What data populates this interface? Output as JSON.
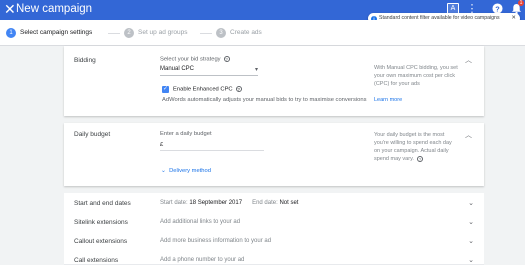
{
  "header": {
    "close_glyph": "✕",
    "title": "New campaign",
    "icons": [
      "tools-icon",
      "more-vert-icon",
      "help-icon",
      "notifications-icon"
    ],
    "notification_count": "1"
  },
  "tooltip": {
    "text": "Standard content filter available for video campaigns",
    "close_glyph": "✕"
  },
  "steps": [
    {
      "num": "1",
      "label": "Select campaign settings"
    },
    {
      "num": "2",
      "label": "Set up ad groups"
    },
    {
      "num": "3",
      "label": "Create ads"
    }
  ],
  "bidding": {
    "label": "Bidding",
    "strategy_prompt": "Select your bid strategy",
    "strategy_value": "Manual CPC",
    "enhanced_label": "Enable Enhanced CPC",
    "enhanced_help": "AdWords automatically adjusts your manual bids to try to maximise conversions",
    "side_text": "With Manual CPC bidding, you set your own maximum cost per click (CPC) for your ads",
    "learn_more": "Learn more"
  },
  "budget": {
    "label": "Daily budget",
    "prompt": "Enter a daily budget",
    "currency": "£",
    "delivery_label": "Delivery method",
    "side_text": "Your daily budget is the most you're willing to spend each day on your campaign. Actual daily spend may vary."
  },
  "rows": [
    {
      "label": "Start and end dates",
      "start_label": "Start date:",
      "start_value": "18 September 2017",
      "end_label": "End date:",
      "end_value": "Not set"
    },
    {
      "label": "Sitelink extensions",
      "value": "Add additional links to your ad"
    },
    {
      "label": "Callout extensions",
      "value": "Add more business information to your ad"
    },
    {
      "label": "Call extensions",
      "value": "Add a phone number to your ad"
    }
  ],
  "colors": {
    "header_blue": "#3367d6",
    "accent_blue": "#4285f4",
    "link_blue": "#1a73e8"
  }
}
